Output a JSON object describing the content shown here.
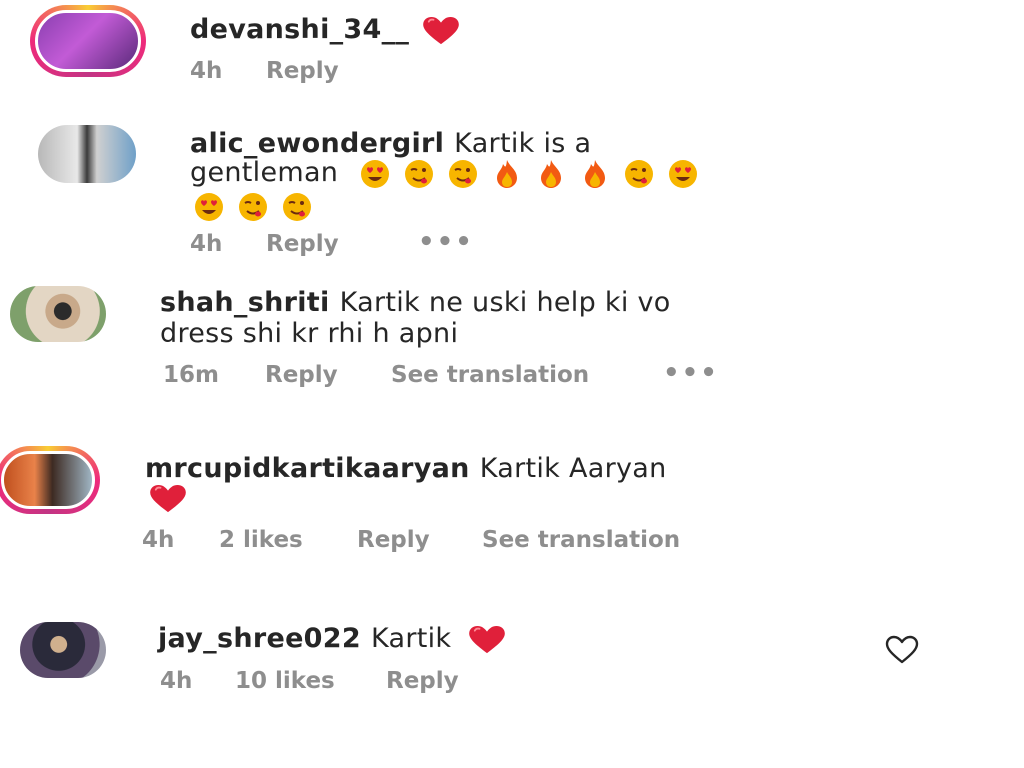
{
  "comments": [
    {
      "username": "devanshi_34__",
      "text": "",
      "time": "4h",
      "reply": "Reply"
    },
    {
      "username": "alic_ewondergirl",
      "text_line1": "Kartik is a",
      "text_line2": "gentleman",
      "time": "4h",
      "reply": "Reply",
      "more": "•••"
    },
    {
      "username": "shah_shriti",
      "text_line1": "Kartik ne uski help ki vo",
      "text_line2": "dress shi kr rhi h apni",
      "time": "16m",
      "reply": "Reply",
      "see_translation": "See translation",
      "more": "•••"
    },
    {
      "username": "mrcupidkartikaaryan",
      "text": "Kartik Aaryan",
      "time": "4h",
      "likes": "2 likes",
      "reply": "Reply",
      "see_translation": "See translation"
    },
    {
      "username": "jay_shree022",
      "text": "Kartik",
      "time": "4h",
      "likes": "10 likes",
      "reply": "Reply"
    }
  ],
  "icons": {
    "heart_emoji": "red-heart",
    "like_button": "heart-outline",
    "heart_eyes": "heart-eyes-emoji",
    "wink": "wink-emoji",
    "fire": "fire-emoji"
  },
  "colors": {
    "heart": "#e0203a",
    "meta_text": "#8e8e8e",
    "text": "#262626",
    "emoji_yellow": "#f7b500",
    "fire_orange": "#f25a12"
  }
}
